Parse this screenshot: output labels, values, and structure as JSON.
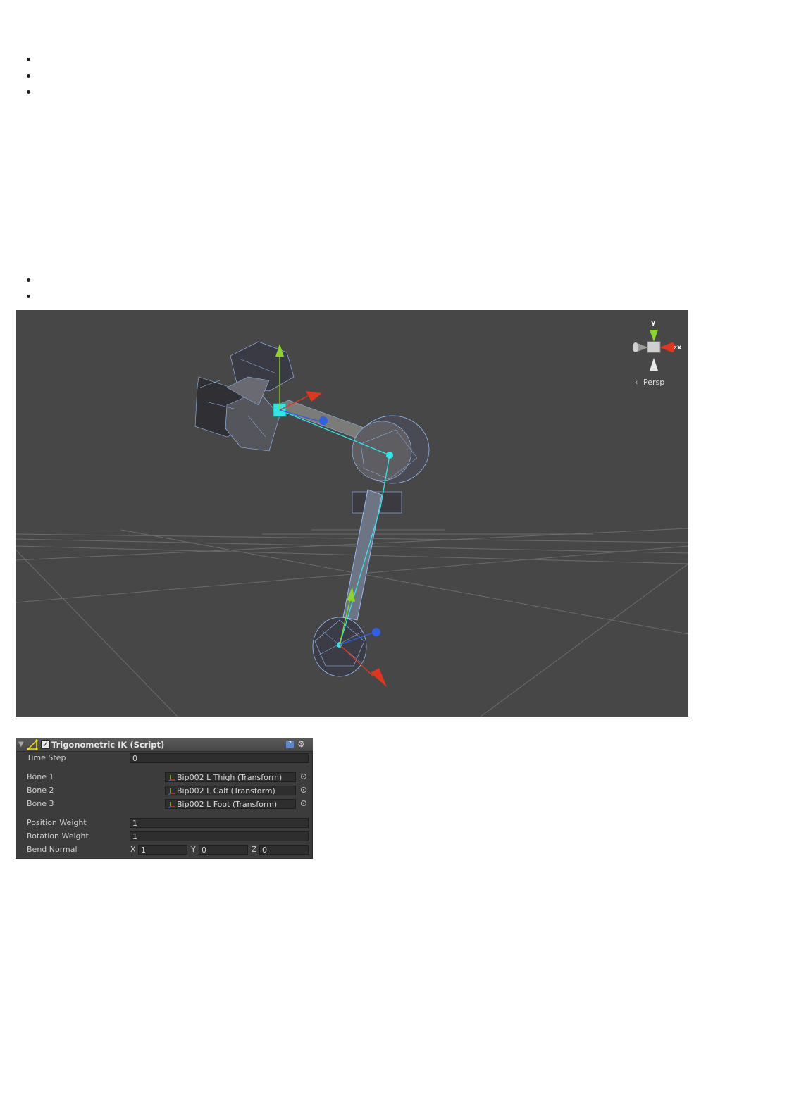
{
  "bullets_top": [
    "",
    "",
    ""
  ],
  "bullets_bottom": [
    "",
    ""
  ],
  "scene": {
    "gizmo_y_label": "y",
    "gizmo_x_label": "x",
    "gizmo_z_label": "z",
    "projection_label": "Persp",
    "colors": {
      "background": "#474747",
      "x_axis": "#e0361d",
      "y_axis": "#8ed42a",
      "z_axis": "#2f5fe6",
      "ik_line": "#2ee6e6",
      "wireframe": "#9bc3ff"
    }
  },
  "inspector": {
    "title": "Trigonometric IK (Script)",
    "enabled": "✓",
    "help_icon": "?",
    "fields": {
      "time_step": {
        "label": "Time Step",
        "value": "0"
      },
      "bone1": {
        "label": "Bone 1",
        "value": "Bip002 L Thigh (Transform)"
      },
      "bone2": {
        "label": "Bone 2",
        "value": "Bip002 L Calf (Transform)"
      },
      "bone3": {
        "label": "Bone 3",
        "value": "Bip002 L Foot (Transform)"
      },
      "position_weight": {
        "label": "Position Weight",
        "value": "1"
      },
      "rotation_weight": {
        "label": "Rotation Weight",
        "value": "1"
      },
      "bend_normal": {
        "label": "Bend Normal",
        "x_label": "X",
        "x": "1",
        "y_label": "Y",
        "y": "0",
        "z_label": "Z",
        "z": "0"
      }
    }
  }
}
